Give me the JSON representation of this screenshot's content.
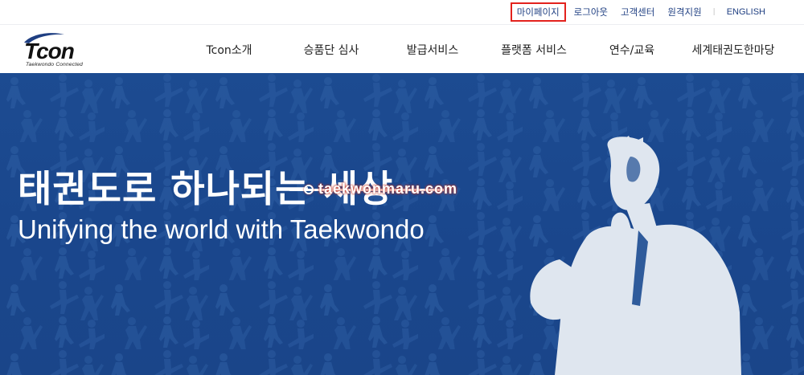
{
  "utility_nav": {
    "mypage": "마이페이지",
    "logout": "로그아웃",
    "support": "고객센터",
    "remote": "원격지원",
    "separator": "|",
    "english": "ENGLISH"
  },
  "brand": {
    "name": "Tcon",
    "tagline": "Taekwondo Connected",
    "accent_color": "#1f3f82",
    "highlight_color": "#e3221d"
  },
  "main_nav": [
    {
      "label": "Tcon소개"
    },
    {
      "label": "승품단 심사"
    },
    {
      "label": "발급서비스"
    },
    {
      "label": "플랫폼 서비스"
    },
    {
      "label": "연수/교육"
    },
    {
      "label": "세계태권도한마당"
    }
  ],
  "hero": {
    "title": "태권도로 하나되는 세상",
    "subtitle": "Unifying the world with Taekwondo",
    "watermark": "taekwonmaru.com",
    "background_color": "#1c4b91"
  }
}
